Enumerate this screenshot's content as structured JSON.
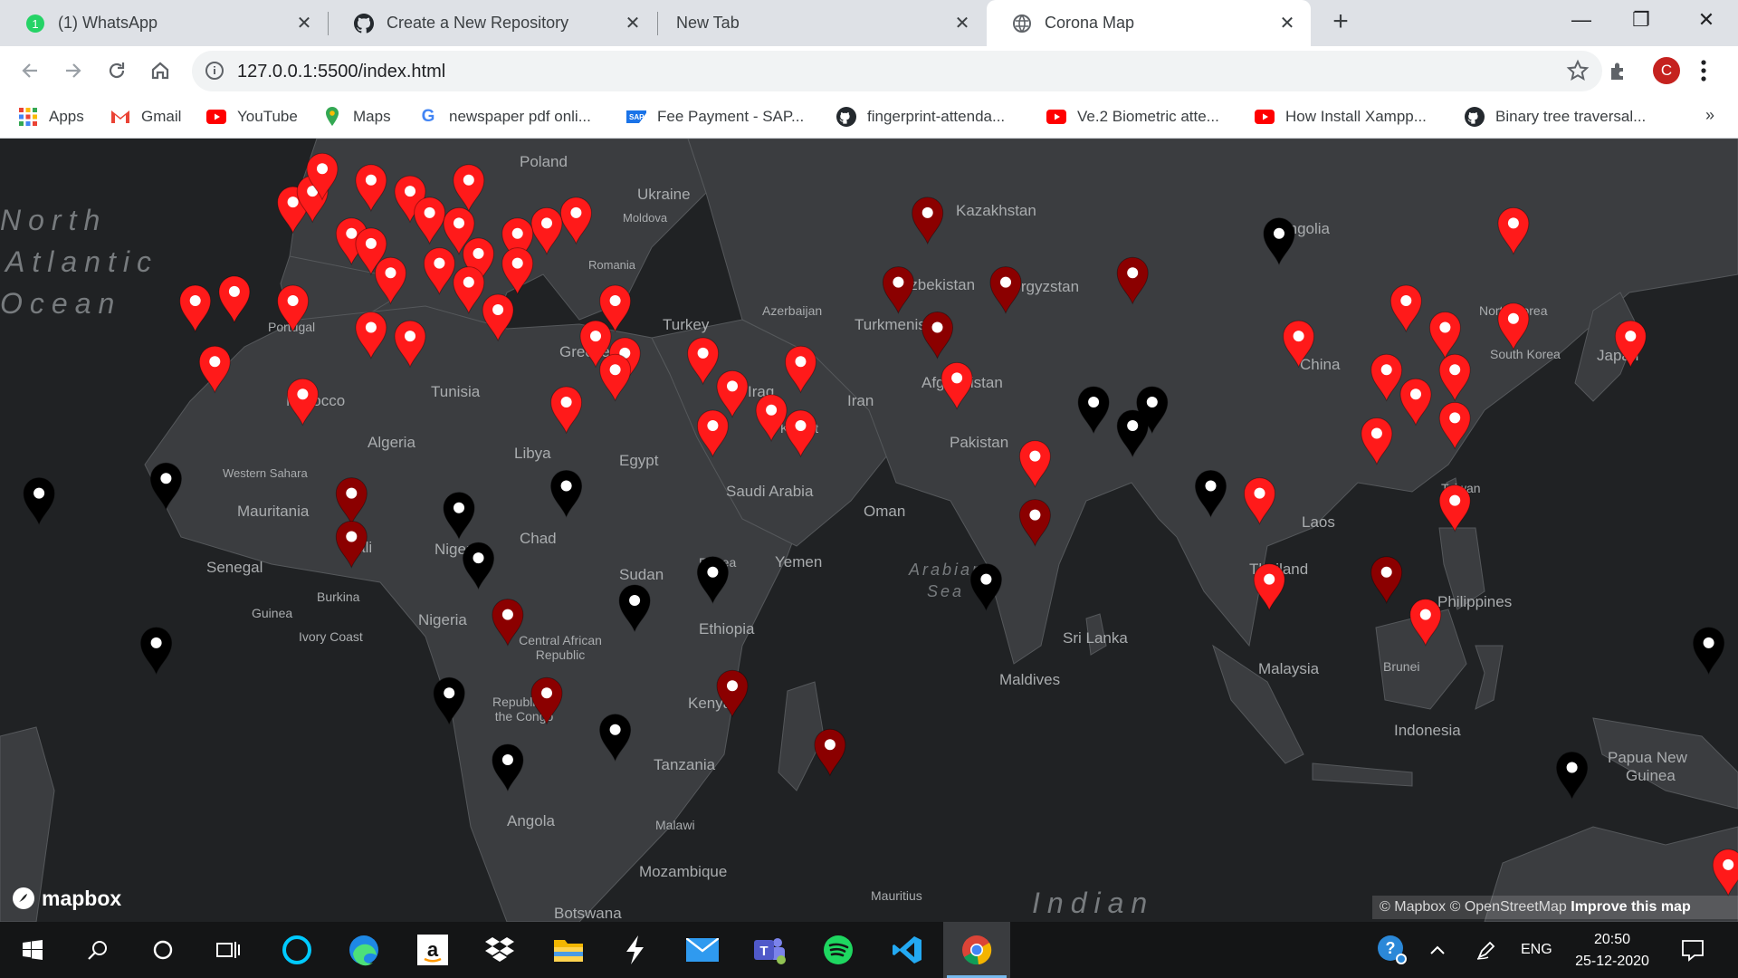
{
  "browser": {
    "tabs": [
      {
        "title": "(1) WhatsApp",
        "icon": "whatsapp-icon",
        "badge": "1"
      },
      {
        "title": "Create a New Repository",
        "icon": "github-icon"
      },
      {
        "title": "New Tab",
        "icon": ""
      },
      {
        "title": "Corona Map",
        "icon": "globe-icon",
        "active": true
      }
    ],
    "url": "127.0.0.1:5500/index.html",
    "profile_initial": "C",
    "bookmarks": [
      {
        "label": "Apps",
        "icon": "apps-grid-icon"
      },
      {
        "label": "Gmail",
        "icon": "gmail-icon"
      },
      {
        "label": "YouTube",
        "icon": "youtube-icon"
      },
      {
        "label": "Maps",
        "icon": "maps-pin-icon"
      },
      {
        "label": "newspaper pdf onli...",
        "icon": "google-icon"
      },
      {
        "label": "Fee Payment - SAP...",
        "icon": "sap-icon"
      },
      {
        "label": "fingerprint-attenda...",
        "icon": "github-icon"
      },
      {
        "label": "Ve.2 Biometric atte...",
        "icon": "youtube-icon"
      },
      {
        "label": "How Install Xampp...",
        "icon": "youtube-icon"
      },
      {
        "label": "Binary tree traversal...",
        "icon": "github-icon"
      }
    ],
    "more": "»"
  },
  "map": {
    "labels": [
      {
        "text": "Kazakhstan"
      },
      {
        "text": "Mongolia"
      },
      {
        "text": "Uzbekistan"
      },
      {
        "text": "Kyrgyzstan"
      },
      {
        "text": "Turkmenistan"
      },
      {
        "text": "Afghanistan"
      },
      {
        "text": "Pakistan"
      },
      {
        "text": "China"
      },
      {
        "text": "North Korea"
      },
      {
        "text": "South Korea"
      },
      {
        "text": "Japan"
      },
      {
        "text": "Taiwan"
      },
      {
        "text": "Laos"
      },
      {
        "text": "Thailand"
      },
      {
        "text": "Philippines"
      },
      {
        "text": "Malaysia"
      },
      {
        "text": "Brunei"
      },
      {
        "text": "Indonesia"
      },
      {
        "text": "Papua New"
      },
      {
        "text": "Guinea"
      },
      {
        "text": "Sri Lanka"
      },
      {
        "text": "Maldives"
      },
      {
        "text": "Iran"
      },
      {
        "text": "Iraq"
      },
      {
        "text": "Kuwait"
      },
      {
        "text": "Oman"
      },
      {
        "text": "Saudi Arabia"
      },
      {
        "text": "Yemen"
      },
      {
        "text": "Turkey"
      },
      {
        "text": "Azerbaijan"
      },
      {
        "text": "Egypt"
      },
      {
        "text": "Libya"
      },
      {
        "text": "Algeria"
      },
      {
        "text": "Tunisia"
      },
      {
        "text": "Greece"
      },
      {
        "text": "Ukraine"
      },
      {
        "text": "Moldova"
      },
      {
        "text": "Poland"
      },
      {
        "text": "Romania"
      },
      {
        "text": "Portugal"
      },
      {
        "text": "Morocco"
      },
      {
        "text": "Western Sahara"
      },
      {
        "text": "Mauritania"
      },
      {
        "text": "Mali"
      },
      {
        "text": "Niger"
      },
      {
        "text": "Chad"
      },
      {
        "text": "Sudan"
      },
      {
        "text": "Eritrea"
      },
      {
        "text": "Ethiopia"
      },
      {
        "text": "Senegal"
      },
      {
        "text": "Guinea"
      },
      {
        "text": "Burkina"
      },
      {
        "text": "Ivory Coast"
      },
      {
        "text": "Nigeria"
      },
      {
        "text": "Central African Republic"
      },
      {
        "text": "Republic of the Congo"
      },
      {
        "text": "Kenya"
      },
      {
        "text": "Tanzania"
      },
      {
        "text": "Angola"
      },
      {
        "text": "Malawi"
      },
      {
        "text": "Mozambique"
      },
      {
        "text": "Botswana"
      },
      {
        "text": "Mauritius"
      }
    ],
    "seas": [
      {
        "text": "North"
      },
      {
        "text": "Atlantic"
      },
      {
        "text": "Ocean"
      },
      {
        "text": "Arabian"
      },
      {
        "text": "Sea"
      },
      {
        "text": "Indian"
      }
    ],
    "pin_colors": {
      "high": "#ff1a1a",
      "mid": "#8b0000",
      "low": "#000000"
    },
    "pins": [
      {
        "lat": 51,
        "lon": 20,
        "level": "high"
      },
      {
        "lat": 48,
        "lon": 31,
        "level": "high"
      },
      {
        "lat": 47,
        "lon": 28,
        "level": "high"
      },
      {
        "lat": 49,
        "lon": 2,
        "level": "high"
      },
      {
        "lat": 50,
        "lon": 4,
        "level": "high"
      },
      {
        "lat": 52,
        "lon": 5,
        "level": "high"
      },
      {
        "lat": 51,
        "lon": 10,
        "level": "high"
      },
      {
        "lat": 50,
        "lon": 14,
        "level": "high"
      },
      {
        "lat": 48,
        "lon": 16,
        "level": "high"
      },
      {
        "lat": 47,
        "lon": 19,
        "level": "high"
      },
      {
        "lat": 46,
        "lon": 8,
        "level": "high"
      },
      {
        "lat": 45,
        "lon": 10,
        "level": "high"
      },
      {
        "lat": 44,
        "lon": 21,
        "level": "high"
      },
      {
        "lat": 46,
        "lon": 25,
        "level": "high"
      },
      {
        "lat": 43,
        "lon": 25,
        "level": "high"
      },
      {
        "lat": 42,
        "lon": 12,
        "level": "high"
      },
      {
        "lat": 43,
        "lon": 17,
        "level": "high"
      },
      {
        "lat": 40,
        "lon": -4,
        "level": "high"
      },
      {
        "lat": 39,
        "lon": -8,
        "level": "high"
      },
      {
        "lat": 39,
        "lon": 2,
        "level": "high"
      },
      {
        "lat": 41,
        "lon": 20,
        "level": "high"
      },
      {
        "lat": 38,
        "lon": 23,
        "level": "high"
      },
      {
        "lat": 35,
        "lon": 14,
        "level": "high"
      },
      {
        "lat": 35,
        "lon": 33,
        "level": "high"
      },
      {
        "lat": 39,
        "lon": 35,
        "level": "high"
      },
      {
        "lat": 36,
        "lon": 10,
        "level": "high"
      },
      {
        "lat": 32,
        "lon": -6,
        "level": "high"
      },
      {
        "lat": 28,
        "lon": 3,
        "level": "high"
      },
      {
        "lat": 27,
        "lon": 30,
        "level": "high"
      },
      {
        "lat": 33,
        "lon": 44,
        "level": "high"
      },
      {
        "lat": 32,
        "lon": 54,
        "level": "high"
      },
      {
        "lat": 29,
        "lon": 47,
        "level": "high"
      },
      {
        "lat": 26,
        "lon": 51,
        "level": "high"
      },
      {
        "lat": 24,
        "lon": 54,
        "level": "high"
      },
      {
        "lat": 24,
        "lon": 45,
        "level": "high"
      },
      {
        "lat": 33,
        "lon": 36,
        "level": "high"
      },
      {
        "lat": 31,
        "lon": 35,
        "level": "high"
      },
      {
        "lat": 30,
        "lon": 70,
        "level": "high"
      },
      {
        "lat": 20,
        "lon": 78,
        "level": "high"
      },
      {
        "lat": 12,
        "lon": 78,
        "level": "mid"
      },
      {
        "lat": 35,
        "lon": 105,
        "level": "high"
      },
      {
        "lat": 31,
        "lon": 114,
        "level": "high"
      },
      {
        "lat": 39,
        "lon": 116,
        "level": "high"
      },
      {
        "lat": 36,
        "lon": 120,
        "level": "high"
      },
      {
        "lat": 31,
        "lon": 121,
        "level": "high"
      },
      {
        "lat": 28,
        "lon": 117,
        "level": "high"
      },
      {
        "lat": 23,
        "lon": 113,
        "level": "high"
      },
      {
        "lat": 25,
        "lon": 121,
        "level": "high"
      },
      {
        "lat": 37,
        "lon": 127,
        "level": "high"
      },
      {
        "lat": 35,
        "lon": 139,
        "level": "high"
      },
      {
        "lat": 47,
        "lon": 127,
        "level": "high"
      },
      {
        "lat": 14,
        "lon": 121,
        "level": "high"
      },
      {
        "lat": 15,
        "lon": 101,
        "level": "high"
      },
      {
        "lat": 3,
        "lon": 102,
        "level": "high"
      },
      {
        "lat": -2,
        "lon": 118,
        "level": "high"
      },
      {
        "lat": 4,
        "lon": 114,
        "level": "mid"
      },
      {
        "lat": -35,
        "lon": 149,
        "level": "high"
      },
      {
        "lat": 48,
        "lon": 67,
        "level": "mid"
      },
      {
        "lat": 41,
        "lon": 64,
        "level": "mid"
      },
      {
        "lat": 41,
        "lon": 75,
        "level": "mid"
      },
      {
        "lat": 42,
        "lon": 88,
        "level": "mid"
      },
      {
        "lat": 36,
        "lon": 68,
        "level": "mid"
      },
      {
        "lat": 46,
        "lon": 103,
        "level": "low"
      },
      {
        "lat": 27,
        "lon": 90,
        "level": "low"
      },
      {
        "lat": 24,
        "lon": 88,
        "level": "low"
      },
      {
        "lat": 27,
        "lon": 84,
        "level": "low"
      },
      {
        "lat": 16,
        "lon": 96,
        "level": "low"
      },
      {
        "lat": 3,
        "lon": 73,
        "level": "low"
      },
      {
        "lat": 17,
        "lon": -11,
        "level": "low"
      },
      {
        "lat": 15,
        "lon": -24,
        "level": "low"
      },
      {
        "lat": 13,
        "lon": 19,
        "level": "low"
      },
      {
        "lat": 16,
        "lon": 30,
        "level": "low"
      },
      {
        "lat": 6,
        "lon": 21,
        "level": "low"
      },
      {
        "lat": 0,
        "lon": 37,
        "level": "low"
      },
      {
        "lat": 4,
        "lon": 45,
        "level": "low"
      },
      {
        "lat": -13,
        "lon": 18,
        "level": "low"
      },
      {
        "lat": -18,
        "lon": 35,
        "level": "low"
      },
      {
        "lat": -22,
        "lon": 24,
        "level": "low"
      },
      {
        "lat": -6,
        "lon": -12,
        "level": "low"
      },
      {
        "lat": 15,
        "lon": 8,
        "level": "mid"
      },
      {
        "lat": 9,
        "lon": 8,
        "level": "mid"
      },
      {
        "lat": -2,
        "lon": 24,
        "level": "mid"
      },
      {
        "lat": -13,
        "lon": 28,
        "level": "mid"
      },
      {
        "lat": -12,
        "lon": 47,
        "level": "mid"
      },
      {
        "lat": -20,
        "lon": 57,
        "level": "mid"
      },
      {
        "lat": 9,
        "lon": 160,
        "level": "mid"
      },
      {
        "lat": -6,
        "lon": 147,
        "level": "low"
      },
      {
        "lat": -23,
        "lon": 133,
        "level": "low"
      }
    ]
  },
  "map_ui": {
    "logo": "mapbox",
    "attribution": "© Mapbox © OpenStreetMap",
    "improve": "Improve this map"
  },
  "taskbar": {
    "apps": [
      "windows-start-icon",
      "search-icon",
      "cortana-icon",
      "task-view-icon",
      "alexa-icon",
      "edge-icon",
      "amazon-icon",
      "dropbox-icon",
      "file-explorer-icon",
      "bolt-icon",
      "mail-icon",
      "teams-icon",
      "spotify-icon",
      "vscode-icon",
      "chrome-icon"
    ],
    "language": "ENG",
    "time": "20:50",
    "date": "25-12-2020"
  }
}
